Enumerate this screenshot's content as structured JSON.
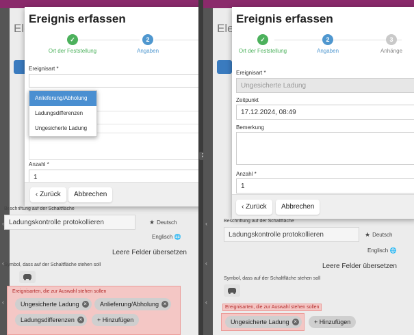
{
  "left": {
    "bg_title": "Ele",
    "dialog_title": "Ereignis erfassen",
    "steps": [
      {
        "label": "Ort der Feststellung",
        "num": "✓",
        "state": "done"
      },
      {
        "label": "Angaben",
        "num": "2",
        "state": "active"
      }
    ],
    "event_type_label": "Ereignisart *",
    "dropdown_options": [
      "Anlieferung/Abholung",
      "Ladungsdifferenzen",
      "Ungesicherte Ladung"
    ],
    "count_label": "Anzahl *",
    "count_value": "1",
    "back_button": "‹ Zurück",
    "cancel_button": "Abbrechen",
    "bg_desc_label": "Beschriftung auf der Schaltfläche",
    "bg_desc_value": "Ladungskontrolle protokollieren",
    "lang_de": "Deutsch",
    "lang_en": "Englisch",
    "translate": "Leere Felder übersetzen",
    "symbol_label": "Symbol, dass auf der Schaltfläche stehen soll",
    "types_label": "Ereignisarten, die zur Auswahl stehen sollen",
    "chips": [
      "Ungesicherte Ladung",
      "Anlieferung/Abholung",
      "Ladungsdifferenzen"
    ],
    "add_chip": "+ Hinzufügen"
  },
  "right": {
    "bg_title": "Ele",
    "dialog_title": "Ereignis erfassen",
    "steps": [
      {
        "label": "Ort der Feststellung",
        "num": "✓",
        "state": "done"
      },
      {
        "label": "Angaben",
        "num": "2",
        "state": "active"
      },
      {
        "label": "Anhänge",
        "num": "3",
        "state": "todo"
      }
    ],
    "event_type_label": "Ereignisart *",
    "event_type_value": "Ungesicherte Ladung",
    "time_label": "Zeitpunkt",
    "time_value": "17.12.2024, 08:49",
    "remark_label": "Bemerkung",
    "count_label": "Anzahl *",
    "count_value": "1",
    "back_button": "‹ Zurück",
    "cancel_button": "Abbrechen",
    "bg_desc_label": "Beschriftung auf der Schaltfläche",
    "bg_desc_value": "Ladungskontrolle protokollieren",
    "lang_de": "Deutsch",
    "lang_en": "Englisch",
    "translate": "Leere Felder übersetzen",
    "symbol_label": "Symbol, dass auf der Schaltfläche stehen soll",
    "types_label": "Ereignisarten, die zur Auswahl stehen sollen",
    "chips": [
      "Ungesicherte Ladung"
    ],
    "add_chip": "+ Hinzufügen"
  },
  "divider_badge": "2",
  "colors": {
    "accent": "#4f97cf",
    "success": "#4cb15c",
    "highlight": "#f4c7c5",
    "topbar": "#8a2a6b"
  }
}
